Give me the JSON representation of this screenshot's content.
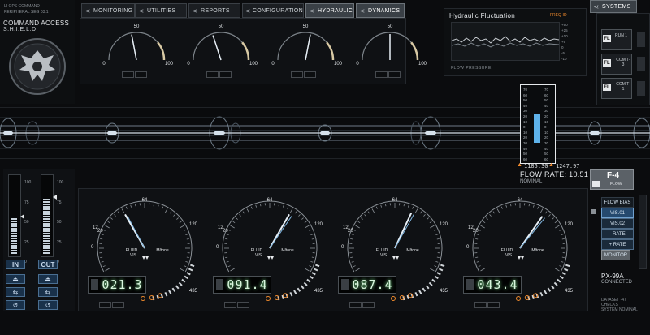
{
  "header": {
    "status_lines": [
      "LI OPS COMMAND",
      "PERIPHERAL SEG 03.1"
    ],
    "command_access": "COMMAND ACCESS",
    "org_name": "S.H.I.E.L.D."
  },
  "nav_tabs": [
    {
      "label": "MONITORING",
      "active": false
    },
    {
      "label": "UTILITIES",
      "active": false
    },
    {
      "label": "REPORTS",
      "active": false
    },
    {
      "label": "CONFIGURATION",
      "active": false
    },
    {
      "label": "HYDRAULIC",
      "active": true
    },
    {
      "label": "DYNAMICS",
      "active": true
    }
  ],
  "systems_button": "SYSTEMS",
  "top_gauges": [
    {
      "min": "0",
      "mid": "50",
      "max": "100",
      "value_pct": 44
    },
    {
      "min": "0",
      "mid": "50",
      "max": "100",
      "value_pct": 40
    },
    {
      "min": "0",
      "mid": "50",
      "max": "100",
      "value_pct": 56
    },
    {
      "min": "0",
      "mid": "50",
      "max": "100",
      "value_pct": 50
    }
  ],
  "fluctuation": {
    "title": "Hydraulic Fluctuation",
    "freq_label": "FREQ-ID",
    "subtitle": "FLOW PRESSURE",
    "axis": [
      "+50",
      "+25",
      "+10",
      "+5",
      "0",
      "-5",
      "-10"
    ]
  },
  "right_stack": [
    {
      "tag": "FL",
      "label": "RUN 1"
    },
    {
      "tag": "FL",
      "label": "COM T-3"
    },
    {
      "tag": "FL",
      "label": "COM T-1"
    }
  ],
  "pressure_column": {
    "scale": [
      "70",
      "60",
      "50",
      "40",
      "30",
      "20",
      "10",
      "0",
      "10",
      "20",
      "30",
      "40",
      "50",
      "60"
    ],
    "reading_left": "1185.30",
    "reading_right": "1247.97",
    "flow_label": "FLOW RATE: 10.51",
    "status": "NOMINAL"
  },
  "flow_box": {
    "label": "F-4",
    "sub": "FLOW"
  },
  "flow_menu": [
    {
      "label": "FLOW BIAS",
      "highlight": false
    },
    {
      "label": "VIS.01",
      "highlight": true
    },
    {
      "label": "VIS.02",
      "highlight": false
    },
    {
      "label": "- RATE",
      "highlight": false
    },
    {
      "label": "+ RATE",
      "highlight": false
    },
    {
      "label": "MONITOR",
      "highlight": false
    }
  ],
  "side_status": {
    "id": "PX-99A",
    "status": "CONNECTED"
  },
  "footer_fine": [
    "DATASET -47",
    "CHECKS",
    "SYSTEM NOMINAL"
  ],
  "left_sliders": {
    "scale": [
      "100",
      "75",
      "50",
      "25",
      "0"
    ],
    "in_label": "IN",
    "out_label": "OUT",
    "in_value_pct": 48,
    "out_value_pct": 72
  },
  "bottom_gauges": [
    {
      "scale_labels": [
        "0",
        "12",
        "20",
        "64",
        "120",
        "435"
      ],
      "fluid": "FLUID",
      "vis": "VIS",
      "unit": "M/tone",
      "readout": "021.3",
      "needle_deg": 240
    },
    {
      "scale_labels": [
        "0",
        "12",
        "20",
        "64",
        "120",
        "435"
      ],
      "fluid": "FLUID",
      "vis": "VIS",
      "unit": "M/tone",
      "readout": "091.4",
      "needle_deg": 300
    },
    {
      "scale_labels": [
        "0",
        "12",
        "20",
        "64",
        "120",
        "435"
      ],
      "fluid": "FLUID",
      "vis": "VIS",
      "unit": "M/tone",
      "readout": "087.4",
      "needle_deg": 295
    },
    {
      "scale_labels": [
        "0",
        "12",
        "20",
        "64",
        "120",
        "435"
      ],
      "fluid": "FLUID",
      "vis": "VIS",
      "unit": "M/tone",
      "readout": "043.4",
      "needle_deg": 305
    }
  ],
  "colors": {
    "accent_blue": "#7fb6e0",
    "warn_orange": "#f08a2c",
    "needle": "#e8f0f7",
    "panel": "#111316"
  }
}
